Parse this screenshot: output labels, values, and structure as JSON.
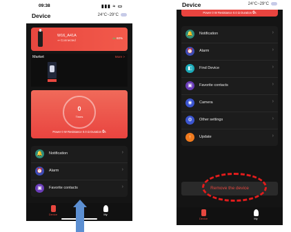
{
  "left_phone": {
    "status_time": "09:38",
    "status_icons": "▮▮▮ ≈ ▭",
    "header_title": "Device",
    "weather": "24°C~29°C",
    "device": {
      "name": "W16_A41A",
      "status": "Connected",
      "battery": "60%"
    },
    "market": {
      "label": "Market",
      "more": "More >"
    },
    "stats": {
      "count": "0",
      "unit": "Times",
      "line": "Power 0 W  Resistance 0.0 Ω  Duration",
      "duration": "0",
      "duration_unit": "s"
    },
    "menu": [
      {
        "label": "Notification",
        "icon": "bell-icon",
        "color": "#2e8d7c",
        "glyph": "🔔"
      },
      {
        "label": "Alarm",
        "icon": "alarm-clock-icon",
        "color": "#3c4bb4",
        "glyph": "⏰"
      },
      {
        "label": "Favorite contacts",
        "icon": "contacts-icon",
        "color": "#6a3cb8",
        "glyph": "▣"
      }
    ],
    "nav": [
      {
        "label": "Device",
        "icon": "device-icon",
        "color": "#e8473f"
      },
      {
        "label": "My",
        "icon": "profile-icon",
        "color": "#ffffff"
      }
    ]
  },
  "right_phone": {
    "header_title": "Device",
    "weather": "24°C~29°C",
    "stats_line": "Power 0 W  Resistance 0.0 Ω  Duration",
    "duration": "0",
    "duration_unit": "s",
    "menu": [
      {
        "label": "Notification",
        "icon": "bell-icon",
        "color": "#2e8d7c",
        "glyph": "🔔"
      },
      {
        "label": "Alarm",
        "icon": "alarm-clock-icon",
        "color": "#3c4bb4",
        "glyph": "⏰"
      },
      {
        "label": "Find Device",
        "icon": "find-device-icon",
        "color": "#1aa9b8",
        "glyph": "◧"
      },
      {
        "label": "Favorite contacts",
        "icon": "contacts-icon",
        "color": "#6a3cb8",
        "glyph": "▣"
      },
      {
        "label": "Camera",
        "icon": "camera-icon",
        "color": "#3b55d0",
        "glyph": "◉"
      },
      {
        "label": "Other settings",
        "icon": "gear-icon",
        "color": "#3b55d0",
        "glyph": "⚙"
      },
      {
        "label": "Update",
        "icon": "update-arrow-icon",
        "color": "#f07a1e",
        "glyph": "↑"
      }
    ],
    "remove_label": "Remove the device",
    "nav": [
      {
        "label": "Device",
        "icon": "device-icon",
        "color": "#e8473f"
      },
      {
        "label": "My",
        "icon": "profile-icon",
        "color": "#ffffff"
      }
    ]
  }
}
